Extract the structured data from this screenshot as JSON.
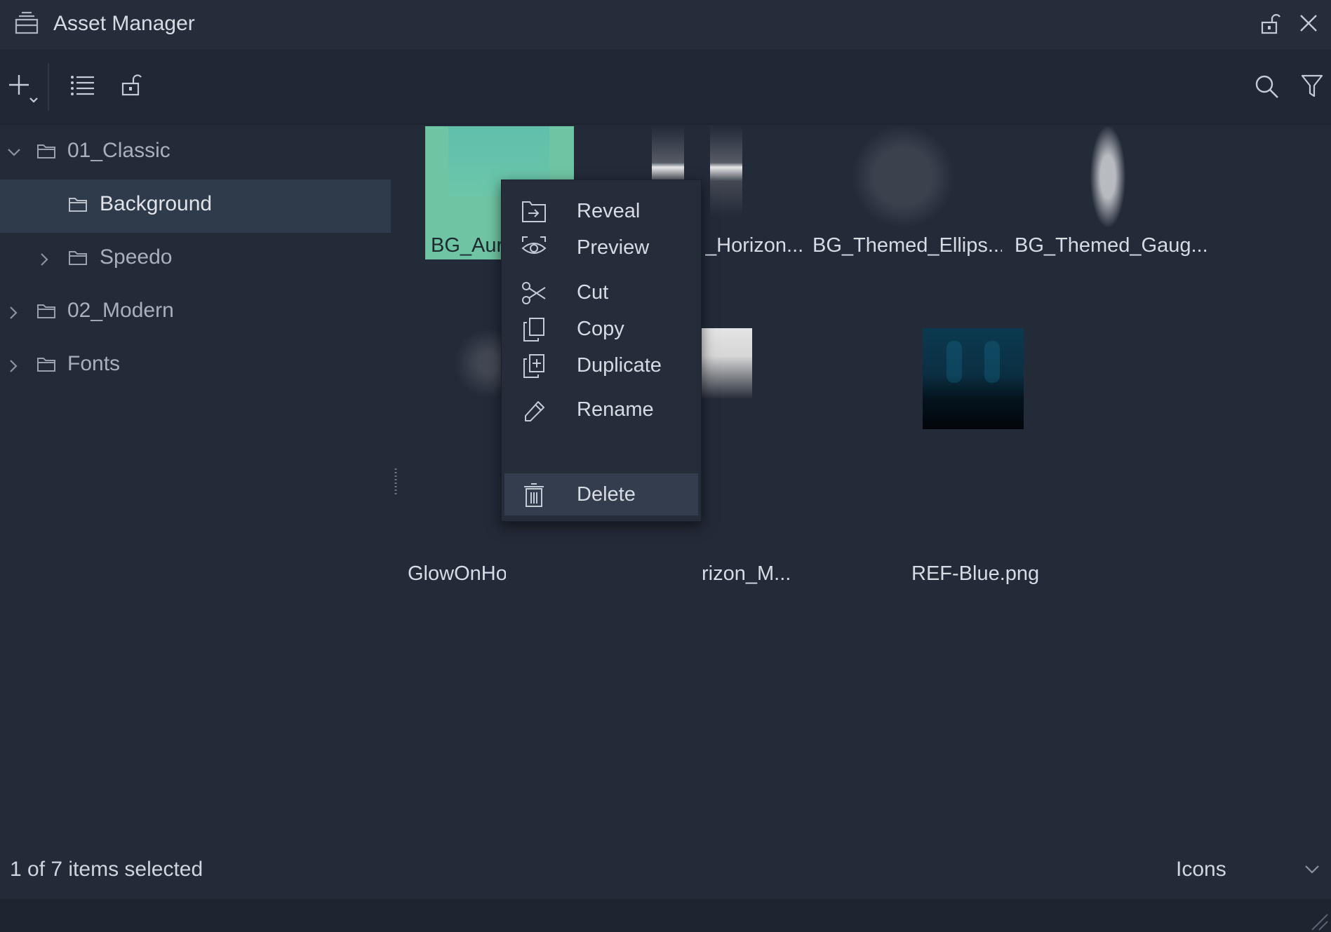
{
  "window": {
    "title": "Asset Manager"
  },
  "toolbar": {
    "add_tooltip": "add",
    "list_view": "list",
    "lock": "lock",
    "search": "search",
    "filter": "filter"
  },
  "tree": {
    "items": [
      {
        "label": "01_Classic",
        "expanded": true,
        "level": 0
      },
      {
        "label": "Background",
        "selected": true,
        "level": 1
      },
      {
        "label": "Speedo",
        "expanded": false,
        "level": 1
      },
      {
        "label": "02_Modern",
        "expanded": false,
        "level": 0
      },
      {
        "label": "Fonts",
        "expanded": false,
        "level": 0
      }
    ]
  },
  "assets": [
    {
      "label": "BG_Aur",
      "selected": true
    },
    {
      "label": "_Horizon..."
    },
    {
      "label": "BG_Themed_Ellips..."
    },
    {
      "label": "BG_Themed_Gaug..."
    },
    {
      "label": "GlowOnHo"
    },
    {
      "label": "rizon_M..."
    },
    {
      "label": "REF-Blue.png"
    }
  ],
  "context_menu": {
    "items": [
      {
        "label": "Reveal",
        "icon": "reveal-icon"
      },
      {
        "label": "Preview",
        "icon": "eye-icon"
      },
      {
        "label": "Cut",
        "icon": "scissors-icon"
      },
      {
        "label": "Copy",
        "icon": "copy-icon"
      },
      {
        "label": "Duplicate",
        "icon": "duplicate-icon"
      },
      {
        "label": "Rename",
        "icon": "pencil-icon"
      },
      {
        "label": "Delete",
        "icon": "trash-icon",
        "hover": true
      }
    ]
  },
  "status": {
    "selection": "1 of 7 items selected",
    "view_mode": "Icons"
  },
  "colors": {
    "background": "#232a38",
    "selected_row": "#2f3a4b",
    "selected_asset": "#6fc4a3",
    "menu_background": "#262d3a",
    "menu_hover": "#333d4e"
  }
}
